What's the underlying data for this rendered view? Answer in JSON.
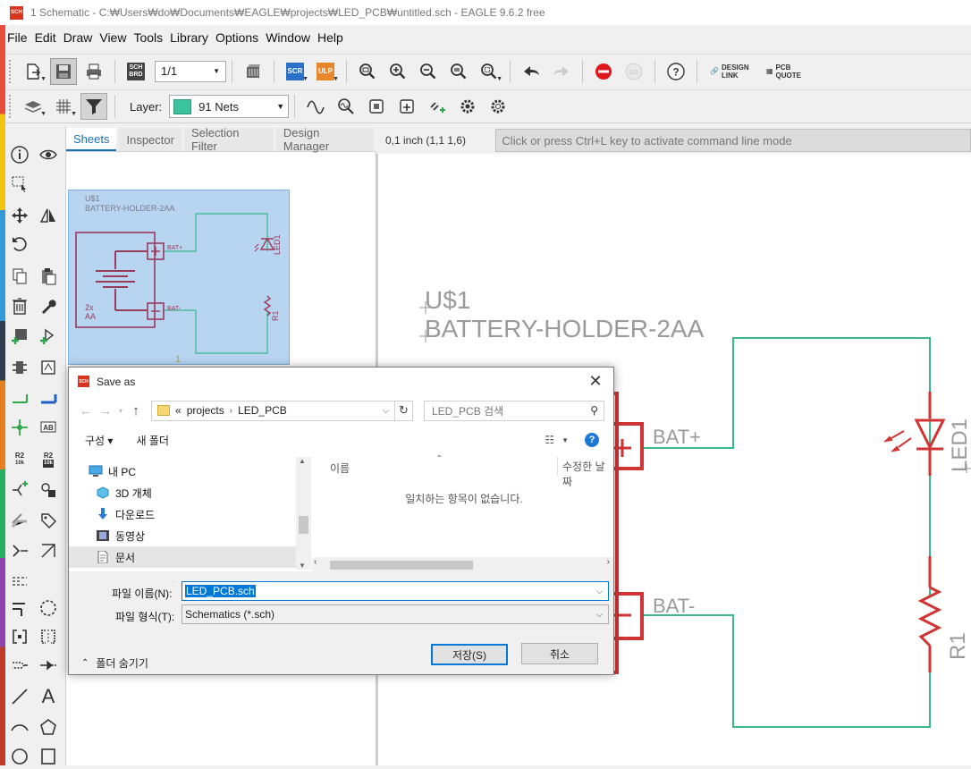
{
  "window": {
    "title": "1 Schematic - C:₩Users₩do₩Documents₩EAGLE₩projects₩LED_PCB₩untitled.sch - EAGLE 9.6.2 free",
    "app_badge": "SCH"
  },
  "menu": [
    "File",
    "Edit",
    "Draw",
    "View",
    "Tools",
    "Library",
    "Options",
    "Window",
    "Help"
  ],
  "toolbar": {
    "sheet_value": "1/1",
    "scr_label": "SCR",
    "ulp_label": "ULP",
    "sch_label": "SCH",
    "brd_label": "BRD",
    "design_link": "DESIGN LINK",
    "pcb_quote": "PCB QUOTE",
    "layer_label": "Layer:",
    "layer_value": "91 Nets",
    "layer_color": "#3ac39c"
  },
  "left_tools": {
    "r2_label": "R2",
    "r2_value": "10k",
    "ab_label": "AB",
    "text_label": "A"
  },
  "panel": {
    "tabs": [
      "Sheets",
      "Inspector",
      "Selection Filter",
      "Design Manager"
    ],
    "active_tab": "Sheets",
    "thumb": {
      "part_name": "U$1",
      "part_value": "BATTERY-HOLDER-2AA",
      "bat_plus": "BAT+",
      "bat_minus": "BAT-",
      "count": "2x",
      "cell": "AA",
      "led": "LED1",
      "res": "R1",
      "sheet_number": "1"
    }
  },
  "canvas": {
    "coord": "0,1 inch (1,1 1,6)",
    "command_placeholder": "Click or press Ctrl+L key to activate command line mode",
    "part_name": "U$1",
    "part_value": "BATTERY-HOLDER-2AA",
    "bat_plus": "BAT+",
    "bat_minus": "BAT-",
    "led": "LED1",
    "res": "R1",
    "net_color": "#3ab88a",
    "part_color": "#d03434"
  },
  "dialog": {
    "title": "Save as",
    "title_badge": "SCH",
    "path": [
      "«",
      "projects",
      "LED_PCB"
    ],
    "search_placeholder": "LED_PCB 검색",
    "organize": "구성 ▾",
    "new_folder": "새 폴더",
    "tree": [
      {
        "label": "내 PC",
        "icon": "pc-icon"
      },
      {
        "label": "3D 개체",
        "icon": "3d-objects-icon"
      },
      {
        "label": "다운로드",
        "icon": "download-icon"
      },
      {
        "label": "동영상",
        "icon": "video-icon"
      },
      {
        "label": "문서",
        "icon": "document-icon"
      }
    ],
    "columns": [
      "이름",
      "수정한 날짜"
    ],
    "empty_message": "일치하는 항목이 없습니다.",
    "filename_label": "파일 이름(N):",
    "filename_value": "LED_PCB.sch",
    "filetype_label": "파일 형식(T):",
    "filetype_value": "Schematics (*.sch)",
    "hide_folders": "폴더 숨기기",
    "save_button": "저장(S)",
    "cancel_button": "취소"
  }
}
